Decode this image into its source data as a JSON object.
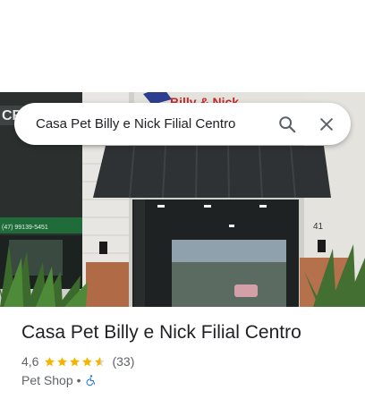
{
  "search": {
    "value": "Casa Pet Billy e Nick Filial Centro",
    "search_icon": "search-icon",
    "close_icon": "close-icon"
  },
  "photo": {
    "sign_left": "CR",
    "sign_top": "Billy & Nick",
    "phone": "(47) 99139-5451",
    "street_number": "41"
  },
  "place": {
    "name": "Casa Pet Billy e Nick Filial Centro",
    "rating": "4,6",
    "rating_value": 4.6,
    "review_count": "(33)",
    "category": "Pet Shop",
    "separator": "•",
    "accessibility_icon": "wheelchair-icon"
  },
  "colors": {
    "star": "#f4b400",
    "star_empty": "#dadce0",
    "title": "#202124",
    "secondary": "#5f6368",
    "accessibility": "#1a73e8"
  }
}
